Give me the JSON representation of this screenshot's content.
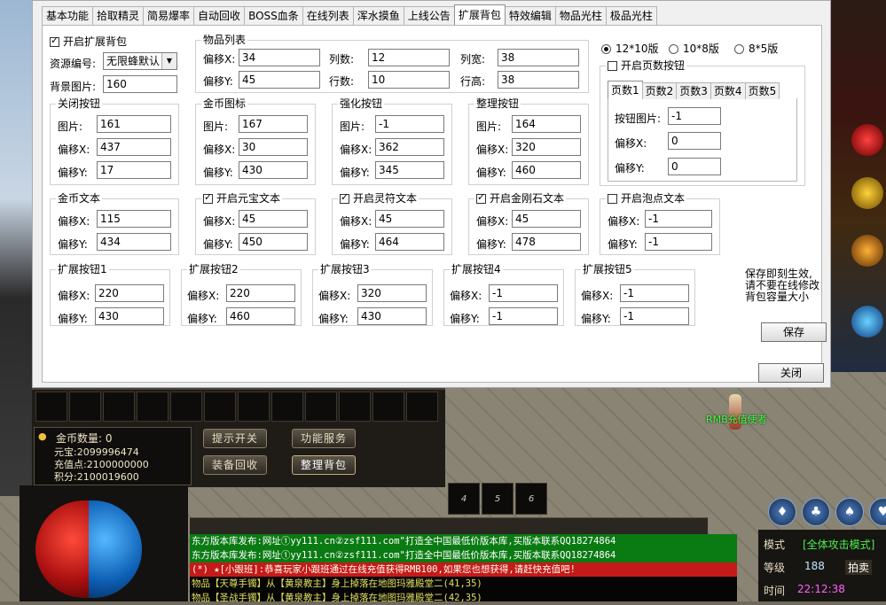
{
  "tabs": [
    "基本功能",
    "拾取精灵",
    "简易爆率",
    "自动回收",
    "BOSS血条",
    "在线列表",
    "浑水摸鱼",
    "上线公告",
    "扩展背包",
    "特效编辑",
    "物品光柱",
    "极品光柱"
  ],
  "active_tab": "扩展背包",
  "enable_bag": {
    "label": "开启扩展背包",
    "checked": true
  },
  "resource": {
    "label": "资源编号:",
    "value": "无限蜂默认"
  },
  "bg_image": {
    "label": "背景图片:",
    "value": "160"
  },
  "item_list": {
    "title": "物品列表",
    "offset_x_label": "偏移X:",
    "offset_x": "34",
    "offset_y_label": "偏移Y:",
    "offset_y": "45",
    "cols_label": "列数:",
    "cols": "12",
    "rows_label": "行数:",
    "rows": "10",
    "col_w_label": "列宽:",
    "col_w": "38",
    "row_h_label": "行高:",
    "row_h": "38"
  },
  "version": {
    "options": [
      "12*10版",
      "10*8版",
      "8*5版"
    ],
    "selected": 0
  },
  "page_btn": {
    "label": "开启页数按钮",
    "checked": false,
    "subtabs": [
      "页数1",
      "页数2",
      "页数3",
      "页数4",
      "页数5"
    ],
    "image_label": "按钮图片:",
    "image": "-1",
    "offset_x_label": "偏移X:",
    "offset_x": "0",
    "offset_y_label": "偏移Y:",
    "offset_y": "0"
  },
  "close_btn_grp": {
    "title": "关闭按钮",
    "img_label": "图片:",
    "img": "161",
    "x_label": "偏移X:",
    "x": "437",
    "y_label": "偏移Y:",
    "y": "17"
  },
  "gold_icon_grp": {
    "title": "金币图标",
    "img_label": "图片:",
    "img": "167",
    "x_label": "偏移X:",
    "x": "30",
    "y_label": "偏移Y:",
    "y": "430"
  },
  "strengthen_grp": {
    "title": "强化按钮",
    "img_label": "图片:",
    "img": "-1",
    "x_label": "偏移X:",
    "x": "362",
    "y_label": "偏移Y:",
    "y": "345"
  },
  "sort_grp": {
    "title": "整理按钮",
    "img_label": "图片:",
    "img": "164",
    "x_label": "偏移X:",
    "x": "320",
    "y_label": "偏移Y:",
    "y": "460"
  },
  "gold_text_grp": {
    "title": "金币文本",
    "x_label": "偏移X:",
    "x": "115",
    "y_label": "偏移Y:",
    "y": "434"
  },
  "yuanbao_grp": {
    "title": "开启元宝文本",
    "checked": true,
    "x_label": "偏移X:",
    "x": "45",
    "y_label": "偏移Y:",
    "y": "450"
  },
  "lingfu_grp": {
    "title": "开启灵符文本",
    "checked": true,
    "x_label": "偏移X:",
    "x": "45",
    "y_label": "偏移Y:",
    "y": "464"
  },
  "diamond_grp": {
    "title": "开启金刚石文本",
    "checked": true,
    "x_label": "偏移X:",
    "x": "45",
    "y_label": "偏移Y:",
    "y": "478"
  },
  "bubble_grp": {
    "title": "开启泡点文本",
    "checked": false,
    "x_label": "偏移X:",
    "x": "-1",
    "y_label": "偏移Y:",
    "y": "-1"
  },
  "ext1": {
    "title": "扩展按钮1",
    "x_label": "偏移X:",
    "x": "220",
    "y_label": "偏移Y:",
    "y": "430"
  },
  "ext2": {
    "title": "扩展按钮2",
    "x_label": "偏移X:",
    "x": "220",
    "y_label": "偏移Y:",
    "y": "460"
  },
  "ext3": {
    "title": "扩展按钮3",
    "x_label": "偏移X:",
    "x": "320",
    "y_label": "偏移Y:",
    "y": "430"
  },
  "ext4": {
    "title": "扩展按钮4",
    "x_label": "偏移X:",
    "x": "-1",
    "y_label": "偏移Y:",
    "y": "-1"
  },
  "ext5": {
    "title": "扩展按钮5",
    "x_label": "偏移X:",
    "x": "-1",
    "y_label": "偏移Y:",
    "y": "-1"
  },
  "note": "保存即刻生效,\n请不要在线修改\n背包容量大小",
  "save_label": "保存",
  "close_label": "关闭",
  "game": {
    "gold_title": "金币数量:",
    "gold_value": "0",
    "yuanbao": "元宝:2099996474",
    "recharge": "充值点:2100000000",
    "points": "积分:2100019600",
    "btn_tip": "提示开关",
    "btn_service": "功能服务",
    "btn_recycle": "装备回收",
    "btn_sort": "整理背包",
    "skills": [
      "4",
      "5",
      "6"
    ],
    "chat": [
      "东方版本库发布:网址①yy111.cn②zsf111.com\"打造全中国最低价版本库,买版本联系QQ18274864",
      "东方版本库发布:网址①yy111.cn②zsf111.com\"打造全中国最低价版本库,买版本联系QQ18274864",
      "(*) ★[小跟班]:恭喜玩家小跟班通过在线充值获得RMB100,如果您也想获得,请赶快充值吧!",
      "物品【天尊手镯】从【黄泉教主】身上掉落在地图玛雅殿堂二(41,35)",
      "物品【圣战手镯】从【黄泉教主】身上掉落在地图玛雅殿堂二(42,35)"
    ],
    "npc": "RMB充值使者",
    "mode_label": "模式",
    "mode_value": "[全体攻击模式]",
    "level_label": "等级",
    "level_value": "188",
    "auction": "拍卖",
    "time_label": "时间",
    "time_value": "22:12:38"
  }
}
